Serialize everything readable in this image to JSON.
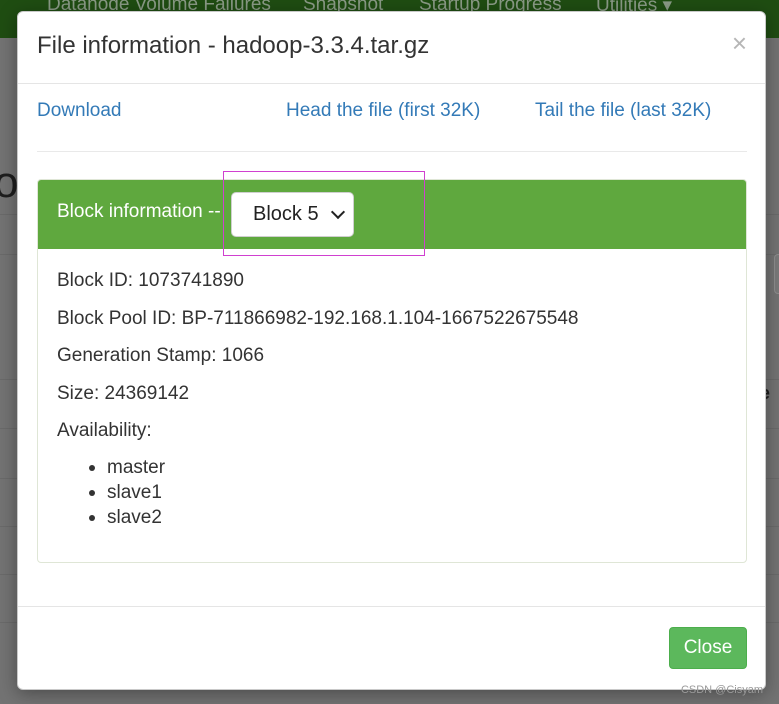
{
  "background": {
    "nav_items": [
      "Datanode Volume Failures",
      "Snapshot",
      "Startup Progress",
      "Utilities ▾"
    ],
    "heading_fragment": "or",
    "right_fragment": "e"
  },
  "modal": {
    "title": "File information - hadoop-3.3.4.tar.gz",
    "close_symbol": "×",
    "links": {
      "download": "Download",
      "head": "Head the file (first 32K)",
      "tail": "Tail the file (last 32K)"
    },
    "block_panel": {
      "heading": "Block information --",
      "selected_block": "Block 5",
      "block_id": "Block ID: 1073741890",
      "block_pool_id": "Block Pool ID: BP-711866982-192.168.1.104-1667522675548",
      "generation_stamp": "Generation Stamp: 1066",
      "size": "Size: 24369142",
      "availability_label": "Availability:",
      "availability": [
        "master",
        "slave1",
        "slave2"
      ]
    },
    "close_button": "Close"
  },
  "watermark": "CSDN @Cisyam",
  "colors": {
    "panel_heading": "#5fa83e",
    "link": "#337ab7",
    "close_button": "#5cb85c",
    "navbar": "#1f4d12",
    "highlight": "#d040d0"
  },
  "icons": {
    "close": "close-icon",
    "select_arrow": "chevron-down-icon"
  }
}
